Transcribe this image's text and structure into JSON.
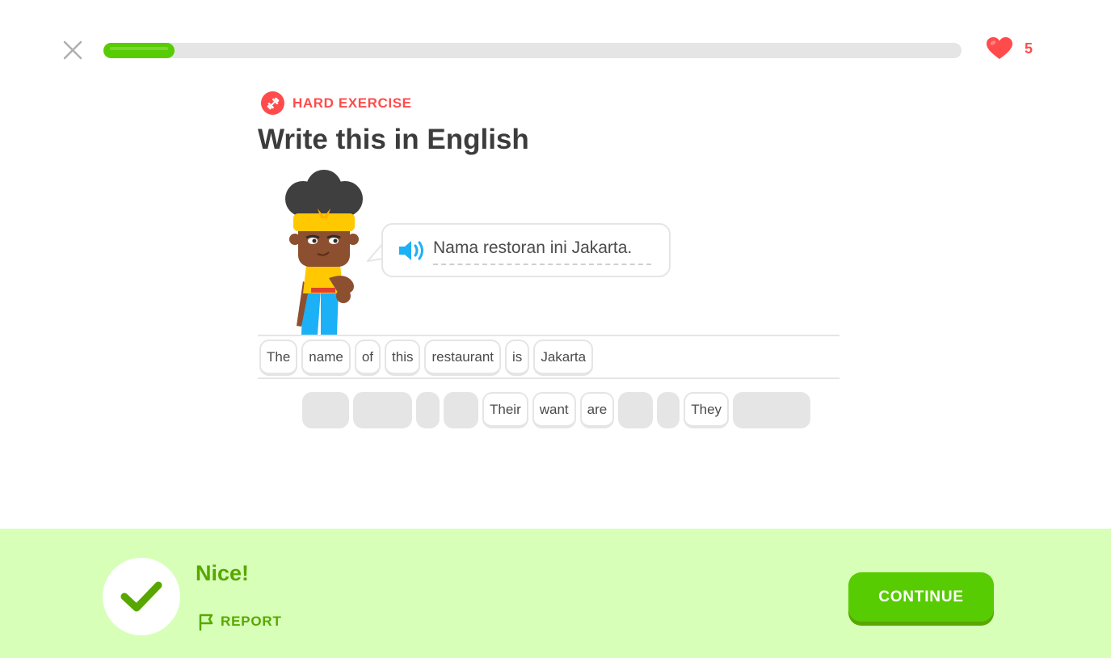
{
  "header": {
    "close_icon": "close-icon",
    "progress_fraction": 0.083,
    "hearts_icon": "heart-icon",
    "hearts_count": "5"
  },
  "exercise": {
    "badge_icon": "dumbbell-icon",
    "badge_label": "HARD EXERCISE",
    "title": "Write this in English",
    "prompt_audio_icon": "speaker-icon",
    "prompt_text": "Nama restoran ini Jakarta."
  },
  "answer": {
    "words": [
      "The",
      "name",
      "of",
      "this",
      "restaurant",
      "is",
      "Jakarta"
    ]
  },
  "word_bank": {
    "visible_words": [
      "Their",
      "want",
      "are",
      "They"
    ]
  },
  "feedback": {
    "status_icon": "checkmark-icon",
    "message": "Nice!",
    "report_icon": "flag-icon",
    "report_label": "REPORT",
    "continue_label": "CONTINUE"
  },
  "colors": {
    "accent_green": "#58cc02",
    "dark_green": "#58a700",
    "footer_bg": "#d7ffb8",
    "heart_red": "#ff4b4b",
    "speaker_blue": "#1cb0f6"
  }
}
